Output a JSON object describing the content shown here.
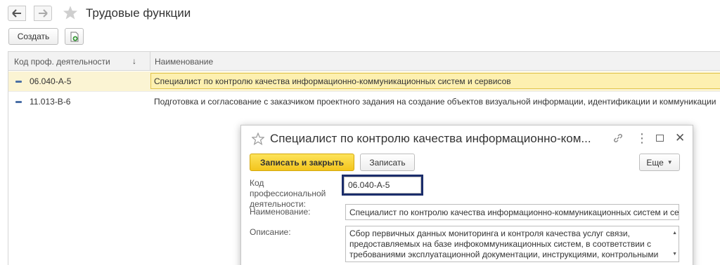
{
  "page": {
    "title": "Трудовые функции"
  },
  "toolbar": {
    "create_label": "Создать"
  },
  "list": {
    "columns": {
      "code": "Код проф. деятельности",
      "name": "Наименование"
    },
    "sort_indicator": "↓",
    "rows": [
      {
        "code": "06.040-А-5",
        "name": "Специалист по контролю качества информационно-коммуникационных систем и сервисов"
      },
      {
        "code": "11.013-В-6",
        "name": "Подготовка и согласование с заказчиком проектного задания на создание объектов визуальной информации, идентификации и коммуникации"
      }
    ]
  },
  "dialog": {
    "title": "Специалист по контролю качества информационно-ком...",
    "buttons": {
      "save_close": "Записать и закрыть",
      "save": "Записать",
      "more": "Еще"
    },
    "fields": {
      "code_label_1": "Код профессиональной",
      "code_label_2": "деятельности:",
      "code_value": "06.040-А-5",
      "name_label": "Наименование:",
      "name_value": "Специалист по контролю качества информационно-коммуникационных систем и сер",
      "desc_label": "Описание:",
      "desc_lines": [
        "Сбор первичных данных мониторинга и контроля качества услуг связи,",
        "предоставляемых на базе инфокоммуникационных систем, в соответствии с",
        "требованиями эксплуатационной документации, инструкциями, контрольными"
      ]
    }
  },
  "colors": {
    "accent_yellow": "#f3c51d",
    "selection_bg": "#fbf4d3",
    "focus_border": "#1b2d6b",
    "tree_marker": "#4a6fa5"
  },
  "icons": [
    "arrow-left-icon",
    "arrow-right-icon",
    "star-icon",
    "document-add-icon",
    "sort-down-icon",
    "link-icon",
    "more-vertical-icon",
    "maximize-icon",
    "close-icon",
    "dropdown-caret-icon"
  ]
}
